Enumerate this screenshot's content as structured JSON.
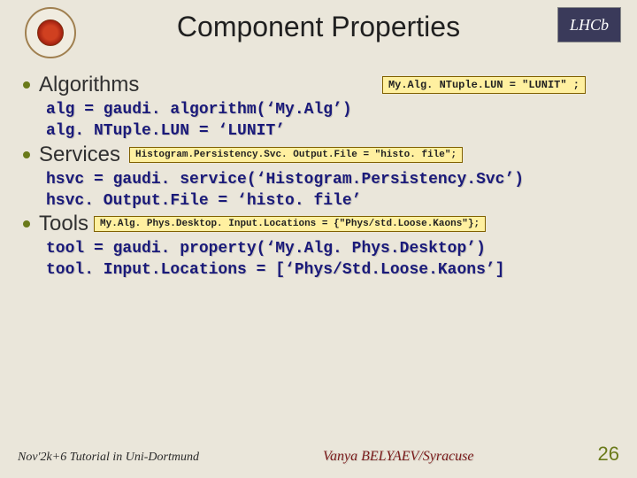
{
  "title": "Component Properties",
  "logo_left_alt": "Syracuse University seal",
  "logo_right_text": "LHCb",
  "sections": [
    {
      "heading": "Algorithms",
      "callout": "My.Alg. NTuple.LUN = \"LUNIT\" ;",
      "code1": "alg = gaudi. algorithm(‘My.Alg’)",
      "code2": "alg. NTuple.LUN = ‘LUNIT’"
    },
    {
      "heading": "Services",
      "callout": "Histogram.Persistency.Svc. Output.File = \"histo. file\";",
      "code1": "hsvc = gaudi. service(‘Histogram.Persistency.Svc’)",
      "code2": "hsvc. Output.File = ‘histo. file’"
    },
    {
      "heading": "Tools",
      "callout": "My.Alg. Phys.Desktop. Input.Locations = {\"Phys/std.Loose.Kaons\"};",
      "code1": "tool = gaudi. property(‘My.Alg. Phys.Desktop’)",
      "code2": "tool. Input.Locations = [‘Phys/Std.Loose.Kaons’]"
    }
  ],
  "footer": {
    "left": "Nov'2k+6  Tutorial in Uni-Dortmund",
    "mid": "Vanya  BELYAEV/Syracuse",
    "page": "26"
  }
}
